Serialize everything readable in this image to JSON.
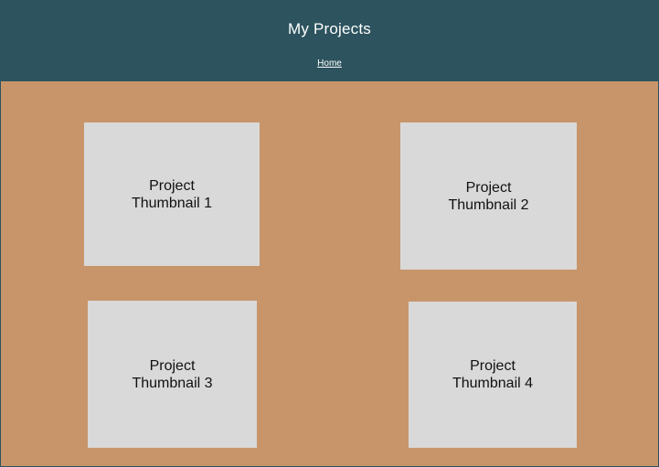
{
  "header": {
    "title": "My Projects",
    "nav_home": "Home"
  },
  "projects": [
    {
      "line1": "Project",
      "line2": "Thumbnail 1"
    },
    {
      "line1": "Project",
      "line2": "Thumbnail 2"
    },
    {
      "line1": "Project",
      "line2": "Thumbnail 3"
    },
    {
      "line1": "Project",
      "line2": "Thumbnail 4"
    }
  ],
  "colors": {
    "header_background": "#2c535e",
    "page_background": "#c8956a",
    "thumbnail_background": "#d9d9d9",
    "header_text": "#ffffff"
  }
}
